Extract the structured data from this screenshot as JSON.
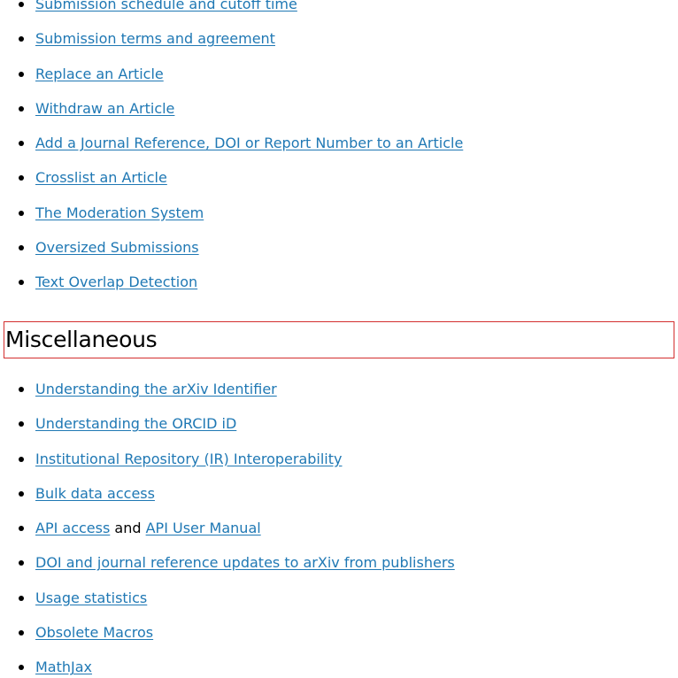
{
  "colors": {
    "link": "#1f78b4",
    "text": "#000000",
    "highlight_border": "#d32f2f",
    "background": "#ffffff"
  },
  "top_list": [
    {
      "label": "Submission schedule and cutoff time"
    },
    {
      "label": "Submission terms and agreement"
    },
    {
      "label": "Replace an Article"
    },
    {
      "label": "Withdraw an Article"
    },
    {
      "label": "Add a Journal Reference, DOI or Report Number to an Article"
    },
    {
      "label": "Crosslist an Article"
    },
    {
      "label": "The Moderation System"
    },
    {
      "label": "Oversized Submissions"
    },
    {
      "label": "Text Overlap Detection"
    }
  ],
  "miscellaneous": {
    "heading": "Miscellaneous",
    "items": [
      {
        "label": "Understanding the arXiv Identifier"
      },
      {
        "label": "Understanding the ORCID iD"
      },
      {
        "label": "Institutional Repository (IR) Interoperability"
      },
      {
        "label": "Bulk data access"
      },
      {
        "label": "API access",
        "joiner": " and ",
        "label2": "API User Manual"
      },
      {
        "label": "DOI and journal reference updates to arXiv from publishers"
      },
      {
        "label": "Usage statistics"
      },
      {
        "label": "Obsolete Macros"
      },
      {
        "label": "MathJax"
      }
    ]
  }
}
